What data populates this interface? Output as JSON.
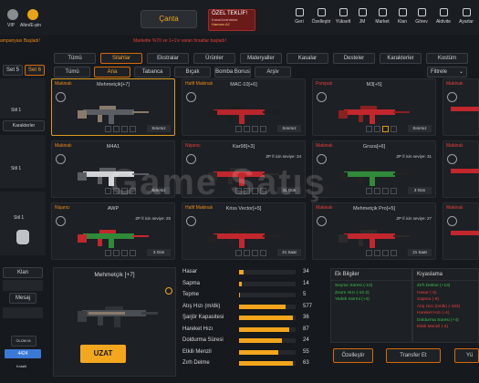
{
  "top": {
    "vip": "VIP",
    "altin": "Altın/E-pin",
    "campaign": "ampanyası Başladı!",
    "title": "Çanta",
    "offer_title": "ÖZEL TEKLİF!",
    "offer_sub": "Kasa/Anahtarlar",
    "offer_item": "Hamam A2",
    "notice": "Markette %70 ve 1+1'e varan fırsatlar başladı!",
    "nav": [
      "Geri",
      "Özelleştir",
      "Yükselt",
      "JM",
      "Market",
      "Klan",
      "Görev",
      "Aktivite",
      "Ayarlar"
    ]
  },
  "left": {
    "set5": "Set 5",
    "set6": "Set 6",
    "chars": "Karakterler",
    "stat1": "Stil 1",
    "stat2": "Stil 1",
    "stat3": "Stil 1",
    "klan": "Klan",
    "mesaj": "Mesaj",
    "olum": "ÖLÜM M.",
    "kills": "4424",
    "kotalti": "Kotalti"
  },
  "filters": {
    "row1": [
      "Tümü",
      "Silahlar",
      "Ekstralar",
      "Ürünler",
      "Materyaller",
      "Kasalar",
      "Desteler",
      "Karakterler",
      "Kostüm"
    ],
    "row2": [
      "Tümü",
      "Ana",
      "Tabanca",
      "Bıçak",
      "Bomba Bonus",
      "Arşiv"
    ],
    "filter_label": "Filtrele"
  },
  "cards": [
    {
      "type": "Makinalı",
      "name": "Mehmetçik[+7]",
      "badge": "Sınırsız",
      "type_color": "#f08a1a"
    },
    {
      "type": "Hafif Makinalı",
      "name": "MAC-10[+6]",
      "badge": "Sınırsız",
      "type_color": "#f08a1a"
    },
    {
      "type": "Pompalı",
      "name": "M3[+5]",
      "badge": "Sınırsız",
      "type_color": "#e8403a"
    },
    {
      "type": "Makinalı",
      "name": "",
      "badge": "",
      "type_color": "#e8403a"
    },
    {
      "type": "Makinalı",
      "name": "M4A1",
      "badge": "Sınırsız",
      "type_color": "#f08a1a"
    },
    {
      "type": "Nişancı",
      "name": "Kar98[+3]",
      "badge": "11 Gün",
      "level": "ZP İl icin seviye: 34",
      "type_color": "#e8403a"
    },
    {
      "type": "Makinalı",
      "name": "Groza[+6]",
      "badge": "3 Gün",
      "level": "ZP İl icin seviye: 31",
      "type_color": "#e8403a"
    },
    {
      "type": "Makinalı",
      "name": "",
      "badge": "",
      "type_color": "#e8403a"
    },
    {
      "type": "Nişancı",
      "name": "AWP",
      "badge": "3 Gün",
      "level": "ZP İl icin seviye: 25",
      "type_color": "#f08a1a"
    },
    {
      "type": "Hafif Makinalı",
      "name": "Kriss Vector[+5]",
      "badge": "21 Saat",
      "type_color": "#f08a1a"
    },
    {
      "type": "Makinalı",
      "name": "Mehmetçik Pro[+5]",
      "badge": "21 Saat",
      "level": "ZP İl icin seviye: 27",
      "type_color": "#e8403a"
    },
    {
      "type": "Makinalı",
      "name": "",
      "badge": "",
      "type_color": "#e8403a"
    }
  ],
  "detail": {
    "name": "Mehmetçik [+7]",
    "button": "UZAT"
  },
  "stats": [
    {
      "label": "Hasar",
      "value": "34",
      "pct": 0.08
    },
    {
      "label": "Sapma",
      "value": "14",
      "pct": 0.05
    },
    {
      "label": "Tepme",
      "value": "5",
      "pct": 0.02
    },
    {
      "label": "Atış Hızı (m/dk)",
      "value": "577",
      "pct": 0.82
    },
    {
      "label": "Şarjör Kapasitesi",
      "value": "36",
      "pct": 0.95
    },
    {
      "label": "Hareket Hızı",
      "value": "87",
      "pct": 0.88
    },
    {
      "label": "Doldurma Süresi",
      "value": "24",
      "pct": 0.75
    },
    {
      "label": "Etkili Menzil",
      "value": "55",
      "pct": 0.7
    },
    {
      "label": "Zırh Delme",
      "value": "63",
      "pct": 0.95
    }
  ],
  "bonus": {
    "title": "Ek Bilgiler",
    "lines": [
      "Seçme Süresi (-10)",
      "Zoom Hızı (-10.2)",
      "Yedek mermi (+4)"
    ]
  },
  "compare": {
    "title": "Kıyaslama",
    "lines": [
      "Zırh Delme (+13)",
      "Hasar (-5)",
      "Sapma (-9)",
      "Atış Hızı (m/dk) (-183)",
      "Hareket Hızı (-4)",
      "Doldurma Süresi (+4)",
      "Etkili Menzil (-4)"
    ]
  },
  "actions": {
    "customize": "Özelleştir",
    "transfer": "Transfer Et",
    "upgrade": "Yü"
  },
  "watermark": "Game Satış"
}
